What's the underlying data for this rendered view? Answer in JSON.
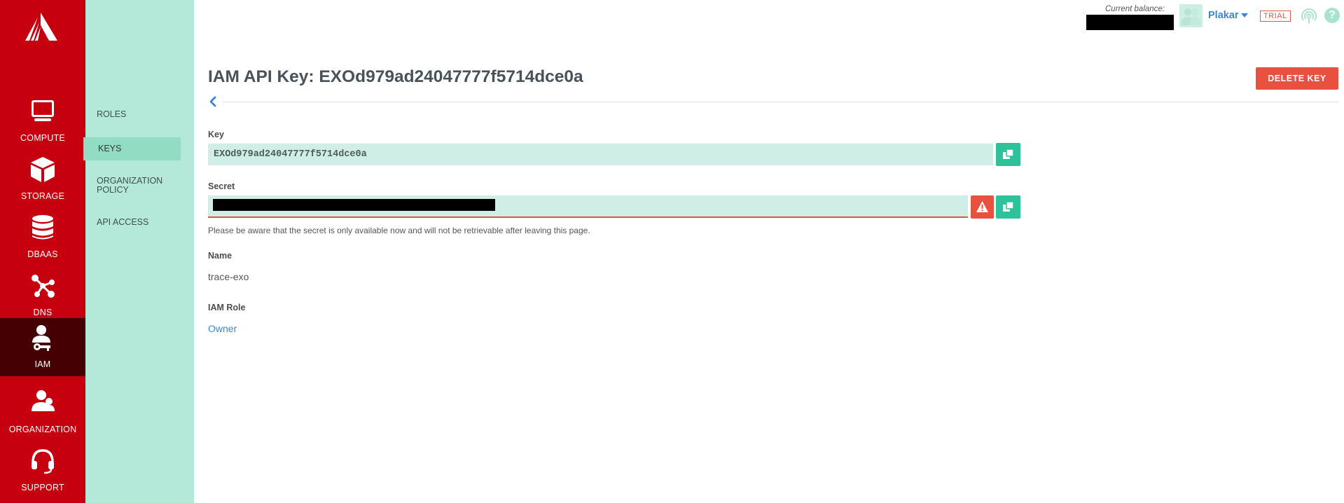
{
  "sidebar": {
    "items": [
      {
        "label": "COMPUTE",
        "icon": "monitor-icon"
      },
      {
        "label": "STORAGE",
        "icon": "cube-icon"
      },
      {
        "label": "DBAAS",
        "icon": "database-icon"
      },
      {
        "label": "DNS",
        "icon": "network-icon"
      },
      {
        "label": "IAM",
        "icon": "user-key-icon",
        "active": true
      },
      {
        "label": "ORGANIZATION",
        "icon": "people-icon"
      },
      {
        "label": "SUPPORT",
        "icon": "headset-icon"
      }
    ]
  },
  "subnav": {
    "items": [
      {
        "label": "ROLES"
      },
      {
        "label": "KEYS",
        "active": true
      },
      {
        "label": "ORGANIZATION POLICY"
      },
      {
        "label": "API ACCESS"
      }
    ]
  },
  "header": {
    "balance_label": "Current balance:",
    "user_name": "Plakar",
    "trial_badge": "TRIAL"
  },
  "main": {
    "title": "IAM API Key: EXOd979ad24047777f5714dce0a",
    "delete_button": "DELETE KEY",
    "key_label": "Key",
    "key_value": "EXOd979ad24047777f5714dce0a",
    "secret_label": "Secret",
    "secret_help": "Please be aware that the secret is only available now and will not be retrievable after leaving this page.",
    "name_label": "Name",
    "name_value": "trace-exo",
    "role_label": "IAM Role",
    "role_value": "Owner"
  },
  "colors": {
    "sidebar_bg": "#c6000f",
    "sidebar_active": "#450004",
    "subnav_bg": "#b4e8d8",
    "accent_green": "#2ec29a",
    "danger": "#e8503f",
    "link": "#3a86d6"
  }
}
